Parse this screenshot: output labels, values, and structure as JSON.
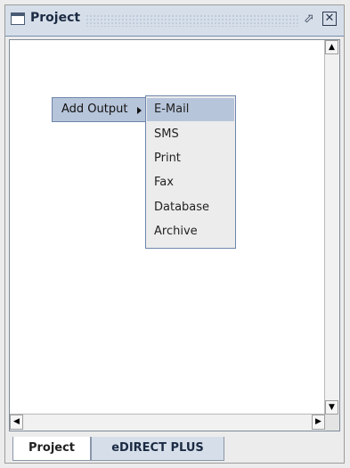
{
  "window": {
    "title": "Project",
    "float_symbol": "⬀",
    "close_symbol": "✕"
  },
  "scrollbars": {
    "up_arrow": "▲",
    "down_arrow": "▼",
    "left_arrow": "◀",
    "right_arrow": "▶"
  },
  "context_menu": {
    "item_label": "Add Output"
  },
  "submenu": {
    "items": [
      "E-Mail",
      "SMS",
      "Print",
      "Fax",
      "Database",
      "Archive"
    ],
    "selected": "E-Mail"
  },
  "tabs": [
    {
      "label": "Project",
      "active": true
    },
    {
      "label": "eDIRECT PLUS",
      "active": false
    }
  ],
  "colors": {
    "selection": "#b7c5da",
    "title_bar": "#d6dfe9",
    "menu_border": "#6e86ab"
  }
}
